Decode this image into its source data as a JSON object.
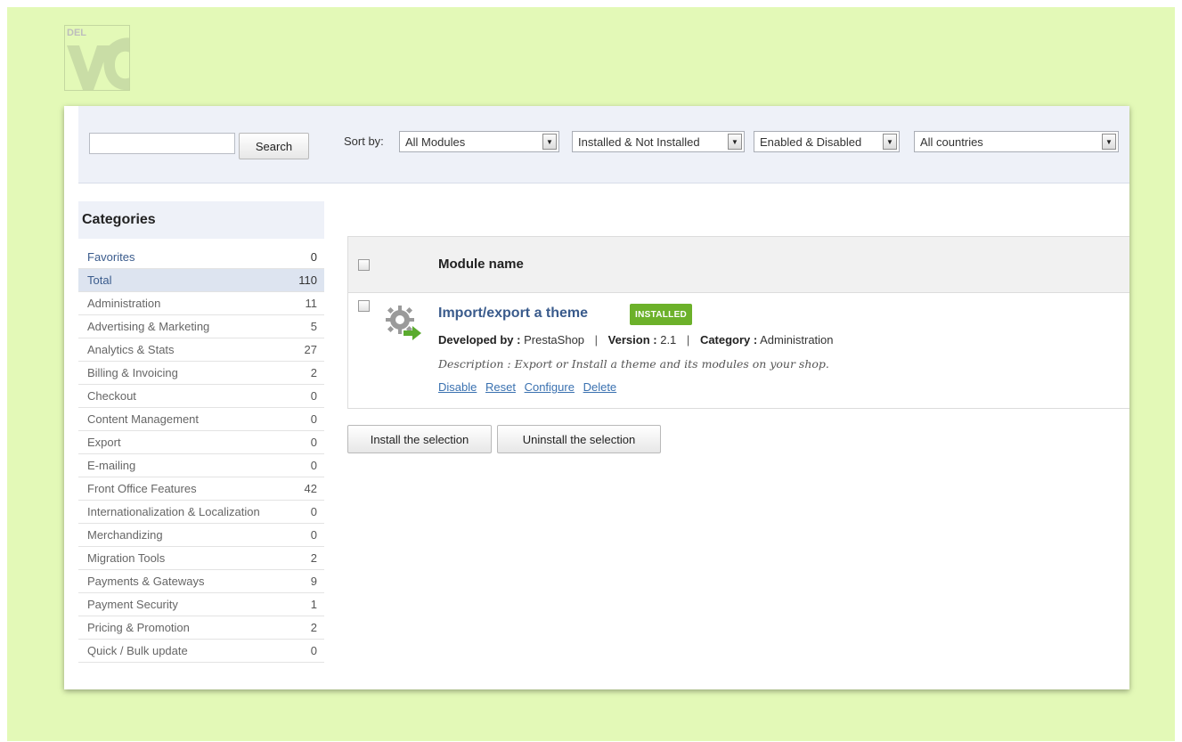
{
  "logo": {
    "text": "DEL"
  },
  "toolbar": {
    "search_placeholder": "",
    "search_label": "Search",
    "sort_label": "Sort by:",
    "filters": [
      "All Modules",
      "Installed & Not Installed",
      "Enabled & Disabled",
      "All countries"
    ]
  },
  "categories": {
    "title": "Categories",
    "items": [
      {
        "label": "Favorites",
        "count": "0"
      },
      {
        "label": "Total",
        "count": "110"
      },
      {
        "label": "Administration",
        "count": "11"
      },
      {
        "label": "Advertising & Marketing",
        "count": "5"
      },
      {
        "label": "Analytics & Stats",
        "count": "27"
      },
      {
        "label": "Billing & Invoicing",
        "count": "2"
      },
      {
        "label": "Checkout",
        "count": "0"
      },
      {
        "label": "Content Management",
        "count": "0"
      },
      {
        "label": "Export",
        "count": "0"
      },
      {
        "label": "E-mailing",
        "count": "0"
      },
      {
        "label": "Front Office Features",
        "count": "42"
      },
      {
        "label": "Internationalization & Localization",
        "count": "0"
      },
      {
        "label": "Merchandizing",
        "count": "0"
      },
      {
        "label": "Migration Tools",
        "count": "2"
      },
      {
        "label": "Payments & Gateways",
        "count": "9"
      },
      {
        "label": "Payment Security",
        "count": "1"
      },
      {
        "label": "Pricing & Promotion",
        "count": "2"
      },
      {
        "label": "Quick / Bulk update",
        "count": "0"
      }
    ]
  },
  "modules": {
    "header_label": "Module name",
    "rows": [
      {
        "name": "Import/export a theme",
        "status": "INSTALLED",
        "developed_label": "Developed by :",
        "developer": "PrestaShop",
        "version_label": "Version :",
        "version": "2.1",
        "category_label": "Category :",
        "category": "Administration",
        "description": "Description : Export or Install a theme and its modules on your shop.",
        "actions": [
          "Disable",
          "Reset",
          "Configure",
          "Delete"
        ],
        "icon": "gear-export-icon"
      }
    ]
  },
  "bulk": {
    "install_label": "Install the selection",
    "uninstall_label": "Uninstall the selection"
  },
  "colors": {
    "background": "#e3f9b7",
    "accent": "#3a5b8c",
    "badge": "#6cb12a",
    "link": "#3a71b0"
  }
}
